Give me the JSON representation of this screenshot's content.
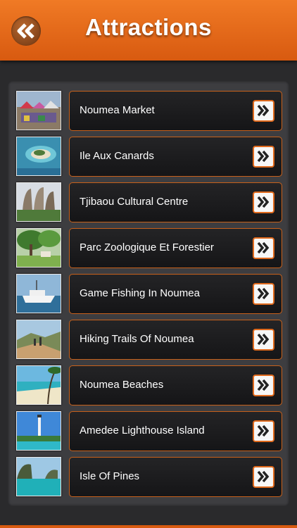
{
  "header": {
    "title": "Attractions"
  },
  "items": [
    {
      "label": "Noumea Market",
      "thumb": "market"
    },
    {
      "label": "Ile Aux Canards",
      "thumb": "island"
    },
    {
      "label": "Tjibaou Cultural Centre",
      "thumb": "cultural"
    },
    {
      "label": "Parc Zoologique Et Forestier",
      "thumb": "park"
    },
    {
      "label": "Game Fishing In Noumea",
      "thumb": "boat"
    },
    {
      "label": "Hiking Trails Of Noumea",
      "thumb": "hiking"
    },
    {
      "label": "Noumea Beaches",
      "thumb": "beach"
    },
    {
      "label": "Amedee Lighthouse Island",
      "thumb": "lighthouse"
    },
    {
      "label": "Isle Of Pines",
      "thumb": "pines"
    }
  ],
  "colors": {
    "accent": "#e06a1d",
    "header": "#e8691c",
    "background": "#2a2a2c"
  }
}
